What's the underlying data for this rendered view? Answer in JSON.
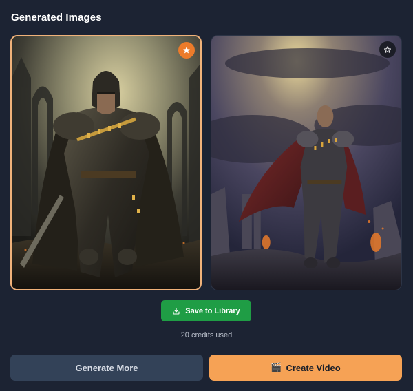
{
  "header": {
    "title": "Generated Images"
  },
  "images": [
    {
      "alt": "Armored knight with rune-engraved plate armor standing before ruined gothic arches",
      "favorite": true,
      "favorite_icon": "star-filled-icon",
      "accent_color": "#ec7b2a",
      "border_color": "#f0b27a"
    },
    {
      "alt": "Bald armored warrior with crimson cape standing among burning ruins under stormy sky",
      "favorite": false,
      "favorite_icon": "star-outline-icon"
    }
  ],
  "actions": {
    "save_label": "Save to Library",
    "save_icon": "download-tray-icon",
    "save_color": "#1f9d45",
    "credits_text": "20 credits used",
    "generate_more_label": "Generate More",
    "create_video_label": "Create Video",
    "create_video_icon": "🎬",
    "create_video_color": "#f6a255"
  }
}
